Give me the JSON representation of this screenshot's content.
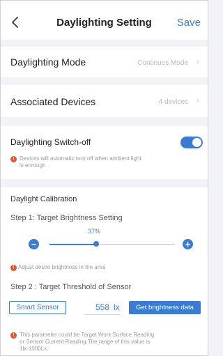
{
  "header": {
    "title": "Daylighting Setting",
    "back_icon": "chevron-left-icon",
    "save_label": "Save"
  },
  "daylighting_mode": {
    "label": "Daylighting Mode",
    "value": "Continues Mode",
    "chevron": "›"
  },
  "associated_devices": {
    "label": "Associated Devices",
    "value": "4 devices",
    "chevron": "›"
  },
  "switch_off": {
    "label": "Daylighting Switch-off",
    "enabled": true,
    "warn_glyph": "!",
    "note_line1": "Devices will automatic turn off when ambient light",
    "note_line2": "is enrough"
  },
  "calibration": {
    "title": "Daylight Calibration",
    "step1": {
      "title": "Step 1: Target Brightness Setting",
      "percent_label": "37%",
      "brightness_fraction": 0.37,
      "minus": "−",
      "plus": "+",
      "note": "Adjust desire brightness in the area"
    },
    "step2": {
      "title": "Step 2 : Target Threshold of Sensor",
      "sensor_button": "Smart Sensor",
      "lux_value": "558",
      "lux_unit": "lx",
      "get_button": "Get brightness data",
      "note_line1": "This parameter could be Target Work Surface Reading",
      "note_line2": "or Sensor Current Reading.The range of this value is",
      "note_line3": "1lx-1000Lx."
    }
  },
  "colors": {
    "accent": "#3a7bd5",
    "warning": "#e0562f",
    "background": "#f2f3f7"
  }
}
